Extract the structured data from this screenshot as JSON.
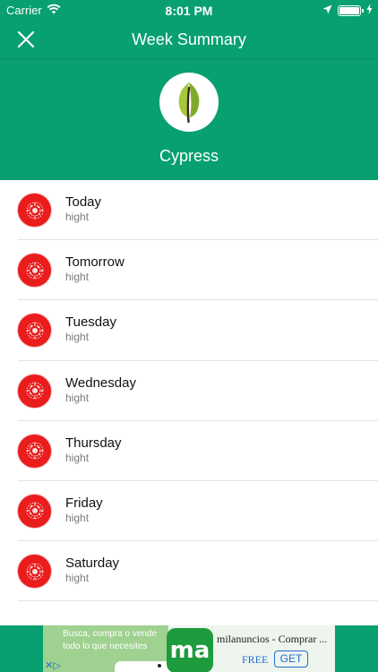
{
  "status_bar": {
    "carrier": "Carrier",
    "time": "8:01 PM",
    "battery_level": 1.0
  },
  "nav": {
    "title": "Week Summary"
  },
  "header": {
    "species": "Cypress"
  },
  "days": [
    {
      "name": "Today",
      "level": "hight"
    },
    {
      "name": "Tomorrow",
      "level": "hight"
    },
    {
      "name": "Tuesday",
      "level": "hight"
    },
    {
      "name": "Wednesday",
      "level": "hight"
    },
    {
      "name": "Thursday",
      "level": "hight"
    },
    {
      "name": "Friday",
      "level": "hight"
    },
    {
      "name": "Saturday",
      "level": "hight"
    }
  ],
  "ad": {
    "left_text_line1": "Busca, compra o vende",
    "left_text_line2": "todo lo que necesites",
    "logo_text": "ma",
    "title": "milanuncios - Comprar ...",
    "price": "FREE",
    "cta": "GET",
    "close_label": "✕▷"
  },
  "colors": {
    "primary_green": "#08a070",
    "level_red": "#ea1c1c"
  },
  "icons": {
    "close": "close-icon",
    "logo": "leaf-icon",
    "day": "pollen-icon"
  }
}
